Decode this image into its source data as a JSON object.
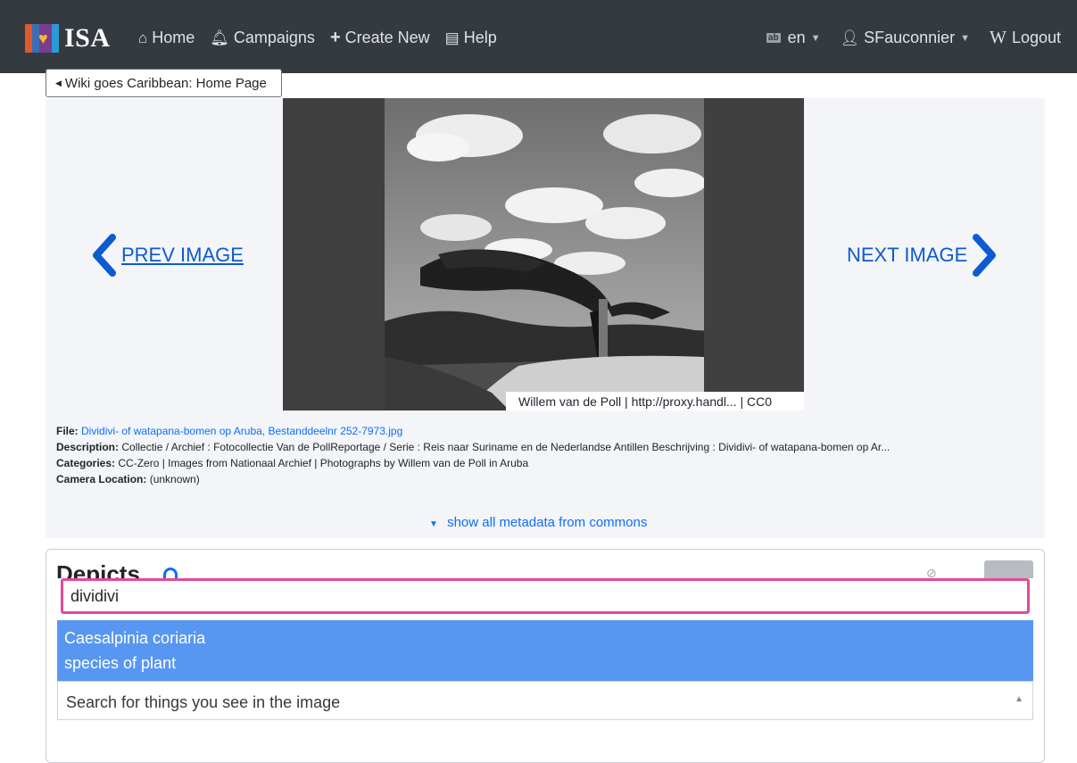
{
  "navbar": {
    "brand": "ISA",
    "left_items": [
      {
        "label": "Home",
        "icon": "home-icon"
      },
      {
        "label": "Campaigns",
        "icon": "bell-icon"
      },
      {
        "label": "Create New",
        "icon": "plus-icon"
      },
      {
        "label": "Help",
        "icon": "book-icon"
      }
    ],
    "language": "en",
    "user": "SFauconnier",
    "logout": "Logout"
  },
  "back_button": "Wiki goes Caribbean: Home Page",
  "viewer": {
    "prev_label": "PREV IMAGE",
    "next_label": "NEXT IMAGE",
    "credit": "Willem van de Poll | http://proxy.handl... | CC0"
  },
  "metadata": {
    "file_label": "File:",
    "file_value": "Dividivi- of watapana-bomen op Aruba, Bestanddeelnr 252-7973.jpg",
    "description_label": "Description:",
    "description_value": "Collectie / Archief : Fotocollectie Van de PollReportage / Serie : Reis naar Suriname en de Nederlandse Antillen Beschrijving : Dividivi- of watapana-bomen op Ar...",
    "categories_label": "Categories:",
    "categories_value": "CC-Zero | Images from Nationaal Archief | Photographs by Willem van de Poll in Aruba",
    "location_label": "Camera Location:",
    "location_value": "(unknown)",
    "show_all": "show all metadata from commons"
  },
  "depicts": {
    "title": "Depicts",
    "search_value": "dividivi",
    "suggestion_name": "Caesalpinia coriaria",
    "suggestion_desc": "species of plant",
    "placeholder": "Search for things you see in the image"
  },
  "colors": {
    "navbar": "#343a40",
    "link": "#0d6efd",
    "nav_arrows": "#0d5ad2",
    "highlight": "#5897f1",
    "focus_border": "#e24a9b"
  }
}
